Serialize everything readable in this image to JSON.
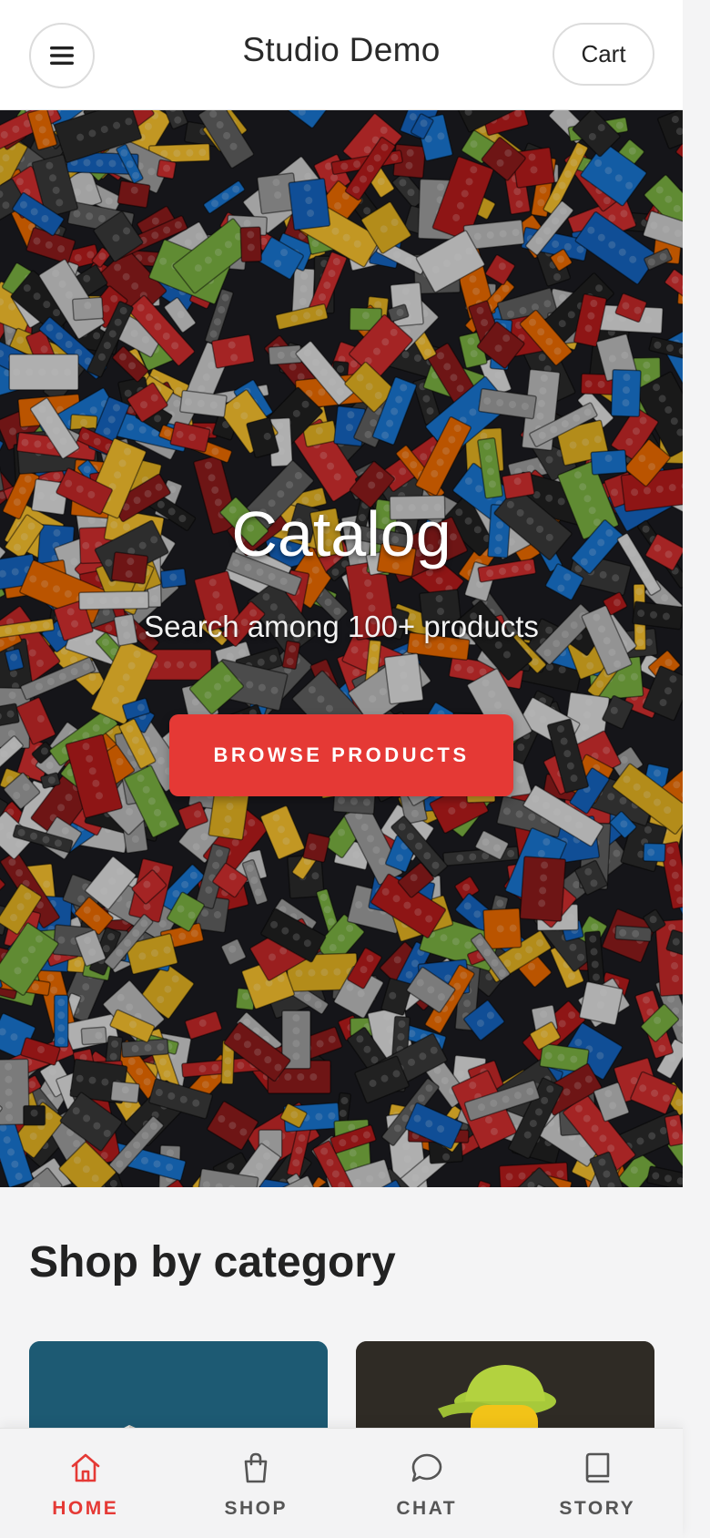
{
  "header": {
    "title": "Studio Demo",
    "menu_icon": "hamburger-menu-icon",
    "cart_label": "Cart"
  },
  "hero": {
    "title": "Catalog",
    "subtitle": "Search among 100+ products",
    "cta_label": "BROWSE PRODUCTS",
    "image": "toy-bricks-photo"
  },
  "categories": {
    "title": "Shop by category",
    "cards": [
      {
        "image": "category-image-1",
        "color": "#1d5a73"
      },
      {
        "image": "category-image-2",
        "color": "#2f2b25"
      }
    ]
  },
  "bottom_nav": {
    "items": [
      {
        "label": "HOME",
        "icon": "home-icon",
        "active": true
      },
      {
        "label": "SHOP",
        "icon": "shopping-bag-icon",
        "active": false
      },
      {
        "label": "CHAT",
        "icon": "chat-bubble-icon",
        "active": false
      },
      {
        "label": "STORY",
        "icon": "book-icon",
        "active": false
      }
    ]
  },
  "colors": {
    "accent": "#e53935",
    "nav_inactive": "#555555"
  }
}
